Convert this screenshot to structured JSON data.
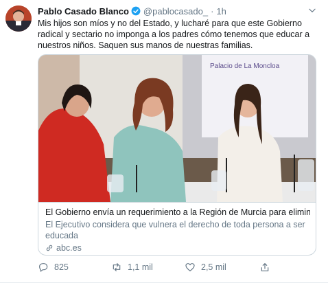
{
  "tweet": {
    "author_name": "Pablo Casado Blanco",
    "handle": "@pablocasado_",
    "separator": "·",
    "time": "1h",
    "text": "Mis hijos son míos y no del Estado, y lucharé para que este Gobierno radical y sectario no imponga a los padres cómo tenemos que educar a nuestros niños. Saquen sus manos de nuestras familias."
  },
  "card": {
    "sign_text": "Palacio de La Moncloa",
    "title": "El Gobierno envía un requerimiento a la Región de Murcia para eliminar...",
    "description": "El Ejecutivo considera que vulnera el derecho de toda persona a ser educada",
    "domain": "abc.es"
  },
  "actions": {
    "replies": "825",
    "retweets": "1,1 mil",
    "likes": "2,5 mil"
  },
  "colors": {
    "verified": "#1da1f2",
    "secondary_text": "#657786",
    "border": "#ccd6dd"
  },
  "icons": [
    "verified-badge-icon",
    "chevron-down-icon",
    "link-icon",
    "reply-icon",
    "retweet-icon",
    "like-icon",
    "share-icon"
  ]
}
